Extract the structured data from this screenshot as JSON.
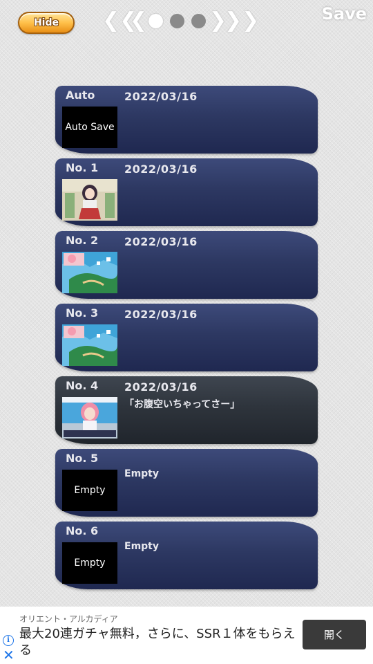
{
  "header": {
    "hide_label": "Hide",
    "title": "Save",
    "pager": {
      "first": "❮❮",
      "prev": "❮",
      "next": "❯",
      "last": "❯❯",
      "page_count": 3,
      "current_page": 1
    }
  },
  "slots": [
    {
      "label": "Auto",
      "date": "2022/03/16",
      "subtitle": "",
      "thumb_text": "Auto Save",
      "thumb_image": "",
      "selected": false
    },
    {
      "label": "No. 1",
      "date": "2022/03/16",
      "subtitle": "",
      "thumb_text": "",
      "thumb_image": "girl-red-skirt",
      "selected": false
    },
    {
      "label": "No. 2",
      "date": "2022/03/16",
      "subtitle": "",
      "thumb_text": "",
      "thumb_image": "town-overview",
      "selected": false
    },
    {
      "label": "No. 3",
      "date": "2022/03/16",
      "subtitle": "",
      "thumb_text": "",
      "thumb_image": "town-overview",
      "selected": false
    },
    {
      "label": "No. 4",
      "date": "2022/03/16",
      "subtitle": "「お腹空いちゃってさー」",
      "thumb_text": "",
      "thumb_image": "girl-pink-hair",
      "selected": true
    },
    {
      "label": "No. 5",
      "date": "",
      "subtitle": "Empty",
      "thumb_text": "Empty",
      "thumb_image": "",
      "selected": false
    },
    {
      "label": "No. 6",
      "date": "",
      "subtitle": "Empty",
      "thumb_text": "Empty",
      "thumb_image": "",
      "selected": false
    }
  ],
  "ad": {
    "sponsor": "オリエント・アルカディア",
    "headline": "最大20連ガチャ無料，さらに、SSR１体をもらえる",
    "cta_label": "開く",
    "info_icon": "info-icon",
    "close_icon": "close-icon"
  },
  "colors": {
    "slot_bg": "#2d3862",
    "slot_selected_bg": "#2e343c",
    "hide_button": "#ffc04a",
    "page_bg": "#e4e4e4"
  }
}
